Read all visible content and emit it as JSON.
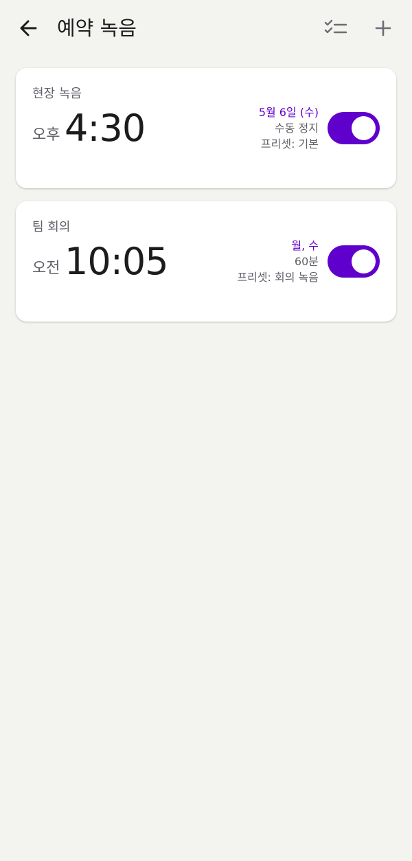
{
  "appbar": {
    "title": "예약 녹음",
    "back_icon": "arrow-back-icon",
    "select_icon": "checklist-icon",
    "add_icon": "plus-icon"
  },
  "schedules": [
    {
      "name": "현장 녹음",
      "ampm": "오후",
      "time": "4:30",
      "schedule": "5월 6일 (수)",
      "stop_mode": "수동 정지",
      "preset": "프리셋: 기본",
      "enabled": true
    },
    {
      "name": "팀 회의",
      "ampm": "오전",
      "time": "10:05",
      "schedule": "월, 수",
      "stop_mode": "60분",
      "preset": "프리셋: 회의 녹음",
      "enabled": true
    }
  ],
  "colors": {
    "accent": "#6000cc",
    "background": "#f3f3ef",
    "card": "#ffffff",
    "secondary_text": "#5f6168"
  }
}
